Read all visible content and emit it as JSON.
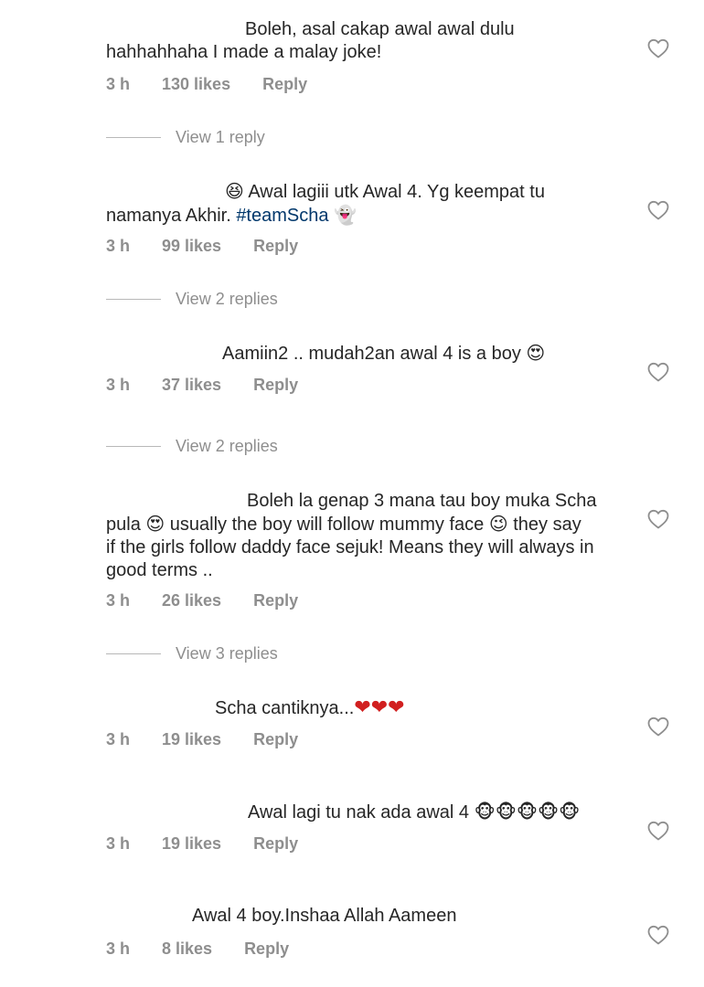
{
  "comments": [
    {
      "lines": [
        "Boleh, asal cakap awal awal dulu",
        "hahhahhaha I made a malay joke!"
      ],
      "time": "3 h",
      "likes": "130 likes",
      "reply": "Reply",
      "view_replies": "View 1 reply"
    },
    {
      "line1_emoji": "😆",
      "line1": "Awal lagiii utk Awal 4. Yg keempat tu",
      "line2": "namanya Akhir.",
      "hashtag": "#teamScha",
      "line2_emoji": "👻",
      "time": "3 h",
      "likes": "99 likes",
      "reply": "Reply",
      "view_replies": "View 2 replies"
    },
    {
      "line1": "Aamiin2 .. mudah2an awal 4 is a boy",
      "line1_emoji": "😍",
      "time": "3 h",
      "likes": "37 likes",
      "reply": "Reply",
      "view_replies": "View 2 replies"
    },
    {
      "line1": "Boleh la genap 3 mana tau boy muka Scha",
      "line2a": "pula",
      "line2_emoji1": "😍",
      "line2b": "usually the boy will follow mummy face",
      "line2_emoji2": "😉",
      "line2c": "they say",
      "line3": "if the girls follow daddy face sejuk! Means they will always in",
      "line4": "good terms ..",
      "time": "3 h",
      "likes": "26 likes",
      "reply": "Reply",
      "view_replies": "View 3 replies"
    },
    {
      "line1": "Scha cantiknya...",
      "line1_emoji": "❤❤❤",
      "time": "3 h",
      "likes": "19 likes",
      "reply": "Reply"
    },
    {
      "line1": "Awal lagi tu nak ada awal 4",
      "line1_emoji": "🐵🐵🐵🐵🐵",
      "time": "3 h",
      "likes": "19 likes",
      "reply": "Reply"
    },
    {
      "line1": "Awal 4 boy.Inshaa Allah Aameen",
      "time": "3 h",
      "likes": "8 likes",
      "reply": "Reply"
    }
  ],
  "icons": {
    "like": "heart-outline-icon"
  },
  "colors": {
    "text": "#262626",
    "meta": "#8e8e8e",
    "hashtag": "#00376b",
    "heart_stroke": "#8e8e8e"
  }
}
